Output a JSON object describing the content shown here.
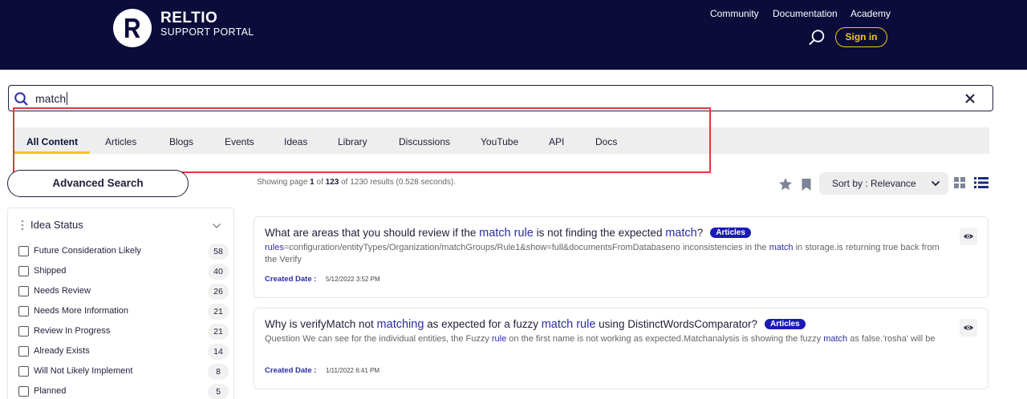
{
  "header": {
    "brand_name": "RELTIO",
    "brand_sub": "SUPPORT PORTAL",
    "nav": [
      "Community",
      "Documentation",
      "Academy"
    ],
    "signin_label": "Sign in"
  },
  "search": {
    "value": "match"
  },
  "tabs": [
    {
      "label": "All Content",
      "active": true
    },
    {
      "label": "Articles"
    },
    {
      "label": "Blogs"
    },
    {
      "label": "Events"
    },
    {
      "label": "Ideas"
    },
    {
      "label": "Library"
    },
    {
      "label": "Discussions"
    },
    {
      "label": "YouTube"
    },
    {
      "label": "API"
    },
    {
      "label": "Docs"
    }
  ],
  "advanced_search_label": "Advanced Search",
  "results_meta": {
    "prefix": "Showing page",
    "page": "1",
    "of1": "of",
    "total_pages": "123",
    "of2": "of 1230 results (0.528 seconds)."
  },
  "sort_label": "Sort by : Relevance",
  "filter": {
    "title": "Idea Status",
    "options": [
      {
        "label": "Future Consideration Likely",
        "count": "58"
      },
      {
        "label": "Shipped",
        "count": "40"
      },
      {
        "label": "Needs Review",
        "count": "26"
      },
      {
        "label": "Needs More Information",
        "count": "21"
      },
      {
        "label": "Review In Progress",
        "count": "21"
      },
      {
        "label": "Already Exists",
        "count": "14"
      },
      {
        "label": "Will Not Likely Implement",
        "count": "8"
      },
      {
        "label": "Planned",
        "count": "5"
      }
    ]
  },
  "results": [
    {
      "title_parts": [
        {
          "t": "What are areas that you should review if the "
        },
        {
          "t": "match rule",
          "hl": true
        },
        {
          "t": " is not finding the expected "
        },
        {
          "t": "match",
          "hl": true
        },
        {
          "t": "?"
        }
      ],
      "badge": "Articles",
      "snippet_parts": [
        {
          "t": "rules",
          "hl": true
        },
        {
          "t": "=configuration/entityTypes/Organization/matchGroups/Rule1&show=full&documentsFromDatabaseno inconsistencies in the "
        },
        {
          "t": "match",
          "hl": true
        },
        {
          "t": " in storage.is returning true back from the Verify"
        }
      ],
      "date_label": "Created Date :",
      "date": "5/12/2022 3:52 PM"
    },
    {
      "title_parts": [
        {
          "t": "Why is verifyMatch not "
        },
        {
          "t": "matching",
          "hl": true
        },
        {
          "t": " as expected for a fuzzy "
        },
        {
          "t": "match rule",
          "hl": true
        },
        {
          "t": " using DistinctWordsComparator?"
        }
      ],
      "badge": "Articles",
      "snippet_parts": [
        {
          "t": "Question We can see for the individual entities, the Fuzzy "
        },
        {
          "t": "rule",
          "hl": true
        },
        {
          "t": " on the first name is not working as expected.Matchanalysis is showing the fuzzy "
        },
        {
          "t": "match",
          "hl": true
        },
        {
          "t": " as false.'rosha' will be"
        }
      ],
      "date_label": "Created Date :",
      "date": "1/11/2022 6:41 PM"
    }
  ],
  "colors": {
    "header_bg": "#0b0c3a",
    "accent_yellow": "#f5c518",
    "highlight_blue": "#2c2ca6",
    "badge_blue": "#1a1ab8",
    "annotation_red": "#e0393e"
  }
}
